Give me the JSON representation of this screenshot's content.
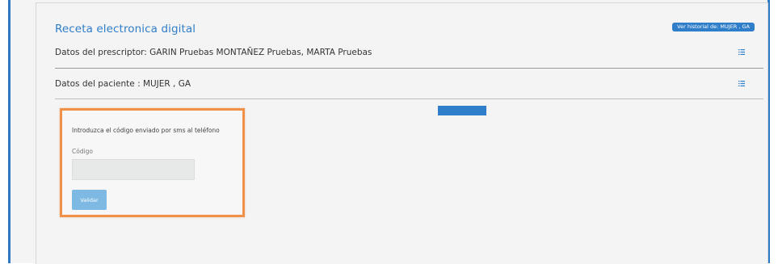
{
  "header": {
    "title": "Receta electronica digital",
    "history_button": "Ver historial de: MUJER , GA"
  },
  "prescriber": {
    "label": "Datos del prescriptor: GARIN Pruebas MONTAÑEZ Pruebas, MARTA Pruebas",
    "icon": "list-icon"
  },
  "patient": {
    "label": "Datos del paciente : MUJER , GA",
    "icon": "list-icon"
  },
  "sms_form": {
    "instruction": "Introduzca el código enviado por sms al teléfono",
    "code_label": "Código",
    "code_value": "",
    "code_placeholder": "",
    "validate_label": "Validar"
  },
  "colors": {
    "accent": "#2f7ec9",
    "highlight_border": "#f0914a",
    "button_light": "#7eb9e3"
  }
}
